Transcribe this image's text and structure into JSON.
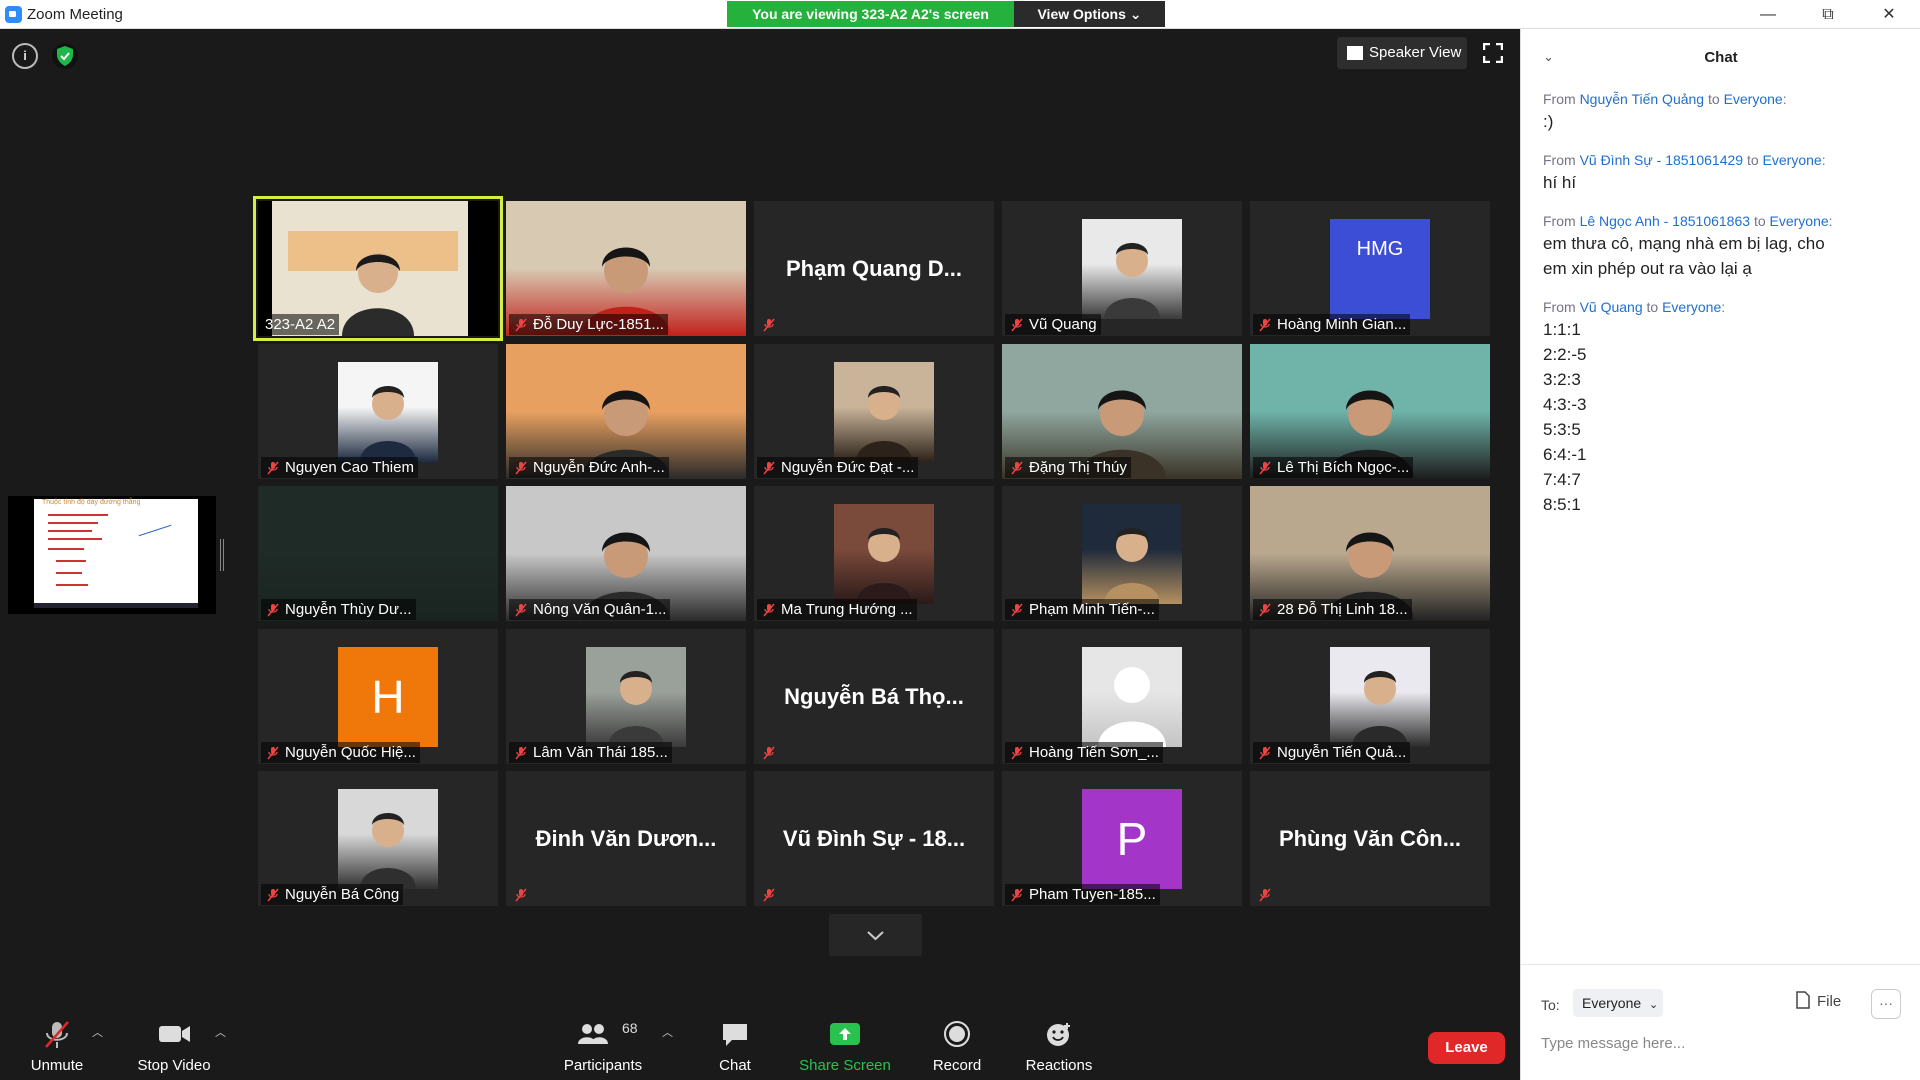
{
  "titlebar": {
    "title": "Zoom Meeting",
    "minimize": "—",
    "restore": "⧉",
    "close": "✕"
  },
  "banner": {
    "viewing_text": "You are viewing 323-A2 A2's screen",
    "view_options": "View Options ⌄"
  },
  "meeting": {
    "speaker_view": "Speaker View",
    "share_thumbnail_title": "Thuộc tính độ dày đường thẳng"
  },
  "tiles": [
    {
      "name": "323-A2 A2",
      "kind": "video",
      "muted": false,
      "active": true,
      "colors": [
        "#f2e6c8",
        "#2b2b2b"
      ]
    },
    {
      "name": "Đỗ Duy Lực-1851...",
      "kind": "video",
      "muted": true,
      "colors": [
        "#d8c9b2",
        "#c0221b"
      ]
    },
    {
      "name": "Phạm Quang D...",
      "kind": "text",
      "muted": true
    },
    {
      "name": "Vũ Quang",
      "kind": "photo",
      "muted": true,
      "colors": [
        "#e9e9e9",
        "#3a3a3a"
      ]
    },
    {
      "name": "Hoàng Minh Gian...",
      "kind": "initials",
      "initials": "HMG",
      "muted": true,
      "colors": [
        "#3d4ed6"
      ]
    },
    {
      "name": "Nguyen Cao Thiem",
      "kind": "photo",
      "muted": true,
      "colors": [
        "#f5f5f5",
        "#1d2a40"
      ]
    },
    {
      "name": "Nguyễn Đức Anh-...",
      "kind": "video",
      "muted": true,
      "colors": [
        "#e8a060",
        "#2a2a2a"
      ]
    },
    {
      "name": "Nguyễn Đức Đạt -...",
      "kind": "photo",
      "muted": true,
      "colors": [
        "#c9b49a",
        "#2c2219"
      ]
    },
    {
      "name": "Đặng Thị Thúy",
      "kind": "video",
      "muted": true,
      "colors": [
        "#8fa79f",
        "#3a3226"
      ]
    },
    {
      "name": "Lê Thị Bích Ngọc-...",
      "kind": "video",
      "muted": true,
      "colors": [
        "#6fb3a9",
        "#1c1c1c"
      ]
    },
    {
      "name": "Nguyễn Thùy Dư...",
      "kind": "video",
      "muted": true,
      "colors": [
        "#1f2b27",
        "#1a2421"
      ]
    },
    {
      "name": "Nông Văn Quân-1...",
      "kind": "video",
      "muted": true,
      "colors": [
        "#c8c8c8",
        "#2a2a2a"
      ]
    },
    {
      "name": "Ma Trung Hướng ...",
      "kind": "photo",
      "muted": true,
      "colors": [
        "#7a4a3a",
        "#2a1a1a"
      ]
    },
    {
      "name": "Phạm Minh Tiến-...",
      "kind": "photo",
      "muted": true,
      "colors": [
        "#1f2a3a",
        "#b59060"
      ]
    },
    {
      "name": "28 Đỗ Thị Linh 18...",
      "kind": "video",
      "muted": true,
      "colors": [
        "#b9a88e",
        "#222222"
      ]
    },
    {
      "name": "Nguyễn Quốc Hiệ...",
      "kind": "initials",
      "initials": "H",
      "muted": true,
      "colors": [
        "#f0780a"
      ]
    },
    {
      "name": "Lâm Văn Thái 185...",
      "kind": "photo",
      "muted": true,
      "colors": [
        "#9aa09a",
        "#3a3a3a"
      ]
    },
    {
      "name": "Nguyễn Bá Thọ...",
      "kind": "text",
      "muted": true
    },
    {
      "name": "Hoàng Tiến Sơn_...",
      "kind": "silhouette",
      "muted": true,
      "colors": [
        "#e6e6e6",
        "#c4c4c4"
      ]
    },
    {
      "name": "Nguyễn Tiến Quả...",
      "kind": "photo",
      "muted": true,
      "colors": [
        "#e9e9ef",
        "#2a2a2a"
      ]
    },
    {
      "name": "Nguyễn Bá Công",
      "kind": "photo",
      "muted": true,
      "colors": [
        "#d8d8d8",
        "#2f2f2f"
      ]
    },
    {
      "name": "Đinh Văn Dươn...",
      "kind": "text",
      "muted": true
    },
    {
      "name": "Vũ Đình Sự - 18...",
      "kind": "text",
      "muted": true
    },
    {
      "name": "Pham Tuyen-185...",
      "kind": "initials",
      "initials": "P",
      "muted": true,
      "colors": [
        "#a336c9"
      ]
    },
    {
      "name": "Phùng Văn Côn...",
      "kind": "text",
      "muted": true
    }
  ],
  "toolbar": {
    "unmute": "Unmute",
    "stop_video": "Stop Video",
    "participants": "Participants",
    "participants_count": "68",
    "chat": "Chat",
    "share_screen": "Share Screen",
    "record": "Record",
    "reactions": "Reactions",
    "leave": "Leave"
  },
  "chat": {
    "title": "Chat",
    "messages": [
      {
        "from_prefix": "From",
        "sender": "Nguyễn Tiến Quảng",
        "to_word": "to",
        "recipient": "Everyone",
        "text": ":)"
      },
      {
        "from_prefix": "From",
        "sender": "Vũ Đình Sự - 1851061429",
        "to_word": "to",
        "recipient": "Everyone",
        "text": "hí hí"
      },
      {
        "from_prefix": "From",
        "sender": "Lê Ngọc Anh - 1851061863",
        "to_word": "to",
        "recipient": "Everyone",
        "text": "em thưa cô, mạng nhà em bị lag, cho\nem xin phép out ra vào lại ạ"
      },
      {
        "from_prefix": "From",
        "sender": "Vũ Quang",
        "to_word": "to",
        "recipient": "Everyone",
        "text": "1:1:1\n2:2:-5\n3:2:3\n4:3:-3\n5:3:5\n6:4:-1\n7:4:7\n8:5:1"
      }
    ],
    "to_label": "To:",
    "to_value": "Everyone",
    "file_label": "File",
    "more_label": "···",
    "input_placeholder": "Type message here..."
  }
}
